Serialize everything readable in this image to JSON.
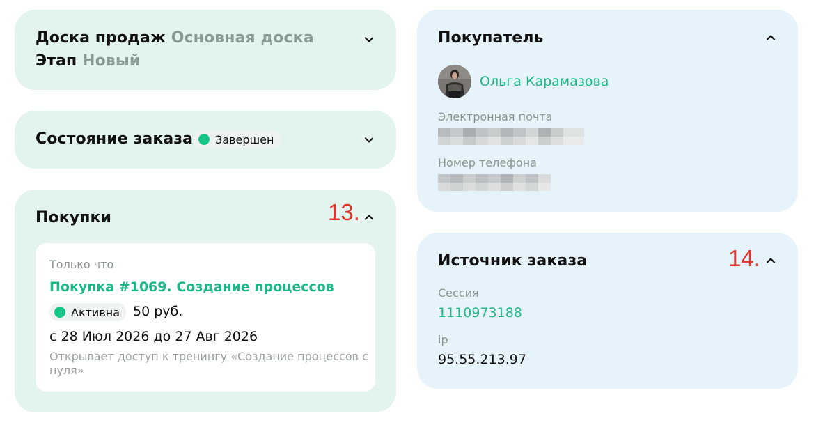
{
  "sales_board": {
    "board_label": "Доска продаж",
    "board_value": "Основная доска",
    "stage_label": "Этап",
    "stage_value": "Новый"
  },
  "order_state": {
    "title": "Состояние заказа",
    "status": "Завершен"
  },
  "purchases": {
    "title": "Покупки",
    "annotation": "13.",
    "item": {
      "time": "Только что",
      "name": "Покупка #1069. Создание процессов",
      "status": "Активна",
      "price": "50 руб.",
      "dates": "с 28 Июл 2026 до 27 Авг 2026",
      "description": "Открывает доступ к тренингу «Создание процессов с нуля»"
    }
  },
  "buyer": {
    "title": "Покупатель",
    "name": "Ольга Карамазова",
    "email_label": "Электронная почта",
    "phone_label": "Номер телефона"
  },
  "order_source": {
    "title": "Источник заказа",
    "annotation": "14.",
    "session_label": "Сессия",
    "session_value": "1110973188",
    "ip_label": "ip",
    "ip_value": "95.55.213.97"
  },
  "colors": {
    "accent": "#1db887",
    "status_dot": "#18c486",
    "green_card": "#e3f3ee",
    "blue_card": "#e7f3fa",
    "annotation": "#e0332b"
  },
  "icons": {
    "collapse": "chevron-down-icon",
    "expand": "chevron-up-icon"
  }
}
